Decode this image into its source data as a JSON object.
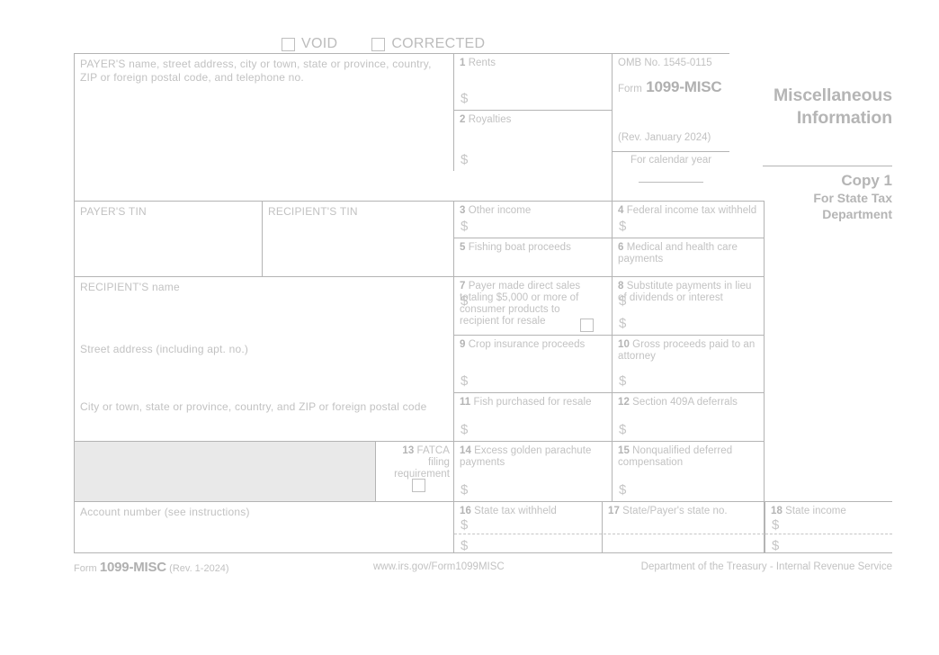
{
  "checkboxes": {
    "void_label": "VOID",
    "corrected_label": "CORRECTED"
  },
  "payer": {
    "name_address_label": "PAYER'S name, street address, city or town, state or province, country, ZIP or foreign postal code, and telephone no.",
    "tin_label": "PAYER'S TIN"
  },
  "recipient": {
    "tin_label": "RECIPIENT'S TIN",
    "name_label": "RECIPIENT'S name",
    "street_label": "Street address (including apt. no.)",
    "city_label": "City or town, state or province, country, and ZIP or foreign postal code",
    "account_label": "Account number (see instructions)"
  },
  "omb": {
    "number": "OMB No. 1545-0115",
    "form_word": "Form",
    "form_number": "1099-MISC",
    "revision": "(Rev. January 2024)",
    "calendar_year_label": "For calendar year"
  },
  "title": {
    "line1": "Miscellaneous",
    "line2": "Information",
    "copy": "Copy 1",
    "copy_sub1": "For State Tax",
    "copy_sub2": "Department"
  },
  "currency_symbol": "$",
  "boxes": [
    {
      "num": "1",
      "label": "Rents"
    },
    {
      "num": "2",
      "label": "Royalties"
    },
    {
      "num": "3",
      "label": "Other income"
    },
    {
      "num": "4",
      "label": "Federal income tax withheld"
    },
    {
      "num": "5",
      "label": "Fishing boat proceeds"
    },
    {
      "num": "6",
      "label": "Medical and health care payments"
    },
    {
      "num": "7",
      "label": "Payer made direct sales totaling $5,000 or more of consumer products to recipient for resale"
    },
    {
      "num": "8",
      "label": "Substitute payments in lieu of dividends or interest"
    },
    {
      "num": "9",
      "label": "Crop insurance proceeds"
    },
    {
      "num": "10",
      "label": "Gross proceeds paid to an attorney"
    },
    {
      "num": "11",
      "label": "Fish purchased for resale"
    },
    {
      "num": "12",
      "label": "Section 409A deferrals"
    },
    {
      "num": "13",
      "label": "FATCA filing requirement"
    },
    {
      "num": "14",
      "label": "Excess golden parachute payments"
    },
    {
      "num": "15",
      "label": "Nonqualified deferred compensation"
    },
    {
      "num": "16",
      "label": "State tax withheld"
    },
    {
      "num": "17",
      "label": "State/Payer's state no."
    },
    {
      "num": "18",
      "label": "State income"
    }
  ],
  "footer": {
    "form_word": "Form",
    "form_number": "1099-MISC",
    "revision": "(Rev. 1-2024)",
    "url": "www.irs.gov/Form1099MISC",
    "agency": "Department of the Treasury - Internal Revenue Service"
  }
}
